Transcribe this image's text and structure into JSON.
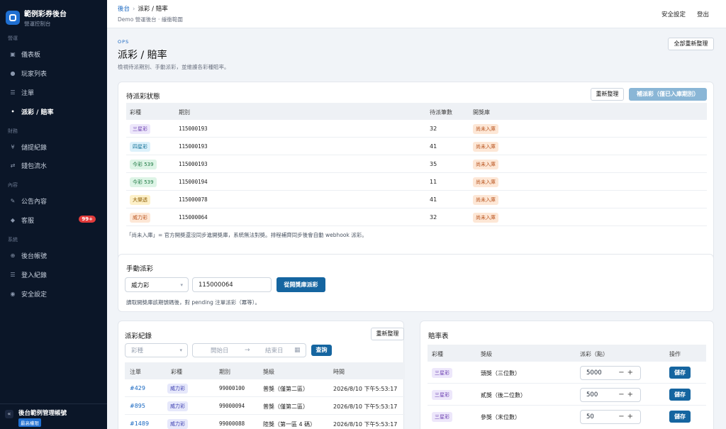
{
  "sidebar": {
    "brand_title": "範例彩券後台",
    "brand_sub": "營運控制台",
    "sections": [
      "營運",
      "財務",
      "內容",
      "系統"
    ],
    "items": [
      {
        "icon": "▣",
        "label": "儀表板"
      },
      {
        "icon": "●",
        "label": "玩家列表"
      },
      {
        "icon": "☰",
        "label": "注單"
      },
      {
        "icon": "•",
        "label": "派彩 / 賠率"
      },
      {
        "icon": "¥",
        "label": "儲提紀錄"
      },
      {
        "icon": "⇄",
        "label": "錢包流水"
      },
      {
        "icon": "✎",
        "label": "公告內容"
      },
      {
        "icon": "◆",
        "label": "客服",
        "badge": "99+"
      },
      {
        "icon": "⊕",
        "label": "後台帳號"
      },
      {
        "icon": "☰",
        "label": "登入紀錄"
      },
      {
        "icon": "◉",
        "label": "安全設定"
      }
    ],
    "footer_title": "後台範例管理帳號",
    "footer_tag": "最高權限",
    "collapse_icon": "«"
  },
  "topbar": {
    "crumb_root": "後台",
    "crumb_sep": "›",
    "crumb_current": "派彩 / 賠率",
    "subtitle": "Demo 營運後台 · 緩衝範圍",
    "link_security": "安全設定",
    "link_logout": "登出"
  },
  "page": {
    "eyebrow": "OPS",
    "title": "派彩 / 賠率",
    "desc": "檢視待派期別、手動派彩，並維護各彩種賠率。",
    "refresh_all": "全部重新整理"
  },
  "pending": {
    "title": "待派彩狀態",
    "refresh": "重新整理",
    "backfill": "補派彩（僅已入庫期別）",
    "headers": [
      "彩種",
      "期別",
      "待派筆數",
      "開獎庫"
    ],
    "rows": [
      {
        "game": "三星彩",
        "period": "115000193",
        "count": "32",
        "status": "尚未入庫",
        "color": "purple"
      },
      {
        "game": "四星彩",
        "period": "115000193",
        "count": "41",
        "status": "尚未入庫",
        "color": "blue"
      },
      {
        "game": "今彩 539",
        "period": "115000193",
        "count": "35",
        "status": "尚未入庫",
        "color": "green"
      },
      {
        "game": "今彩 539",
        "period": "115000194",
        "count": "11",
        "status": "尚未入庫",
        "color": "green"
      },
      {
        "game": "大樂透",
        "period": "115000078",
        "count": "41",
        "status": "尚未入庫",
        "color": "yellow"
      },
      {
        "game": "威力彩",
        "period": "115000064",
        "count": "32",
        "status": "尚未入庫",
        "color": "orange"
      }
    ],
    "note": "「尚未入庫」= 官方開獎還沒同步進開獎庫，系統無法對獎。排程補齊同步後會自動 webhook 派彩。"
  },
  "manual": {
    "title": "手動派彩",
    "game": "威力彩",
    "period": "115000064",
    "action": "從開獎庫派彩",
    "note": "讀取開獎庫該期號碼後，對 pending 注單派彩（冪等）。"
  },
  "records": {
    "title": "派彩紀錄",
    "refresh": "重新整理",
    "filter_game_placeholder": "彩種",
    "date_start": "開始日",
    "date_end": "結束日",
    "query": "查詢",
    "headers": [
      "注單",
      "彩種",
      "期別",
      "獎級",
      "時間"
    ],
    "rows": [
      {
        "id": "#429",
        "game": "威力彩",
        "period": "99000100",
        "prize": "普獎（僅第二區）",
        "time": "2026/8/10 下午5:53:17"
      },
      {
        "id": "#895",
        "game": "威力彩",
        "period": "99000094",
        "prize": "普獎（僅第二區）",
        "time": "2026/8/10 下午5:53:17"
      },
      {
        "id": "#1489",
        "game": "威力彩",
        "period": "99000088",
        "prize": "陸獎（第一區 4 碼）",
        "time": "2026/8/10 下午5:53:17"
      }
    ]
  },
  "odds": {
    "title": "賠率表",
    "headers": [
      "彩種",
      "獎級",
      "派彩（點）",
      "操作"
    ],
    "rows": [
      {
        "game": "三星彩",
        "prize": "頭獎（三位數）",
        "value": "5000",
        "action": "儲存"
      },
      {
        "game": "三星彩",
        "prize": "貳獎（後二位數）",
        "value": "500",
        "action": "儲存"
      },
      {
        "game": "三星彩",
        "prize": "參獎（末位數）",
        "value": "50",
        "action": "儲存"
      }
    ]
  },
  "colors": {
    "sidebar_bg": "#0b1628",
    "primary": "#1565a0",
    "link": "#1565c0",
    "badge_red": "#e23b3b"
  }
}
